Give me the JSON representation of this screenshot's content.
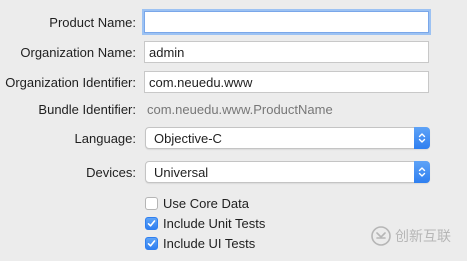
{
  "form": {
    "product_name": {
      "label": "Product Name:",
      "value": ""
    },
    "organization_name": {
      "label": "Organization Name:",
      "value": "admin"
    },
    "organization_identifier": {
      "label": "Organization Identifier:",
      "value": "com.neuedu.www"
    },
    "bundle_identifier": {
      "label": "Bundle Identifier:",
      "value": "com.neuedu.www.ProductName"
    },
    "language": {
      "label": "Language:",
      "selected": "Objective-C"
    },
    "devices": {
      "label": "Devices:",
      "selected": "Universal"
    },
    "options": [
      {
        "label": "Use Core Data",
        "checked": false
      },
      {
        "label": "Include Unit Tests",
        "checked": true
      },
      {
        "label": "Include UI Tests",
        "checked": true
      }
    ]
  },
  "watermark": {
    "text": "创新互联"
  },
  "colors": {
    "accent": "#2f7ff0",
    "focus_ring": "#9cc2f3",
    "background": "#ececec"
  }
}
